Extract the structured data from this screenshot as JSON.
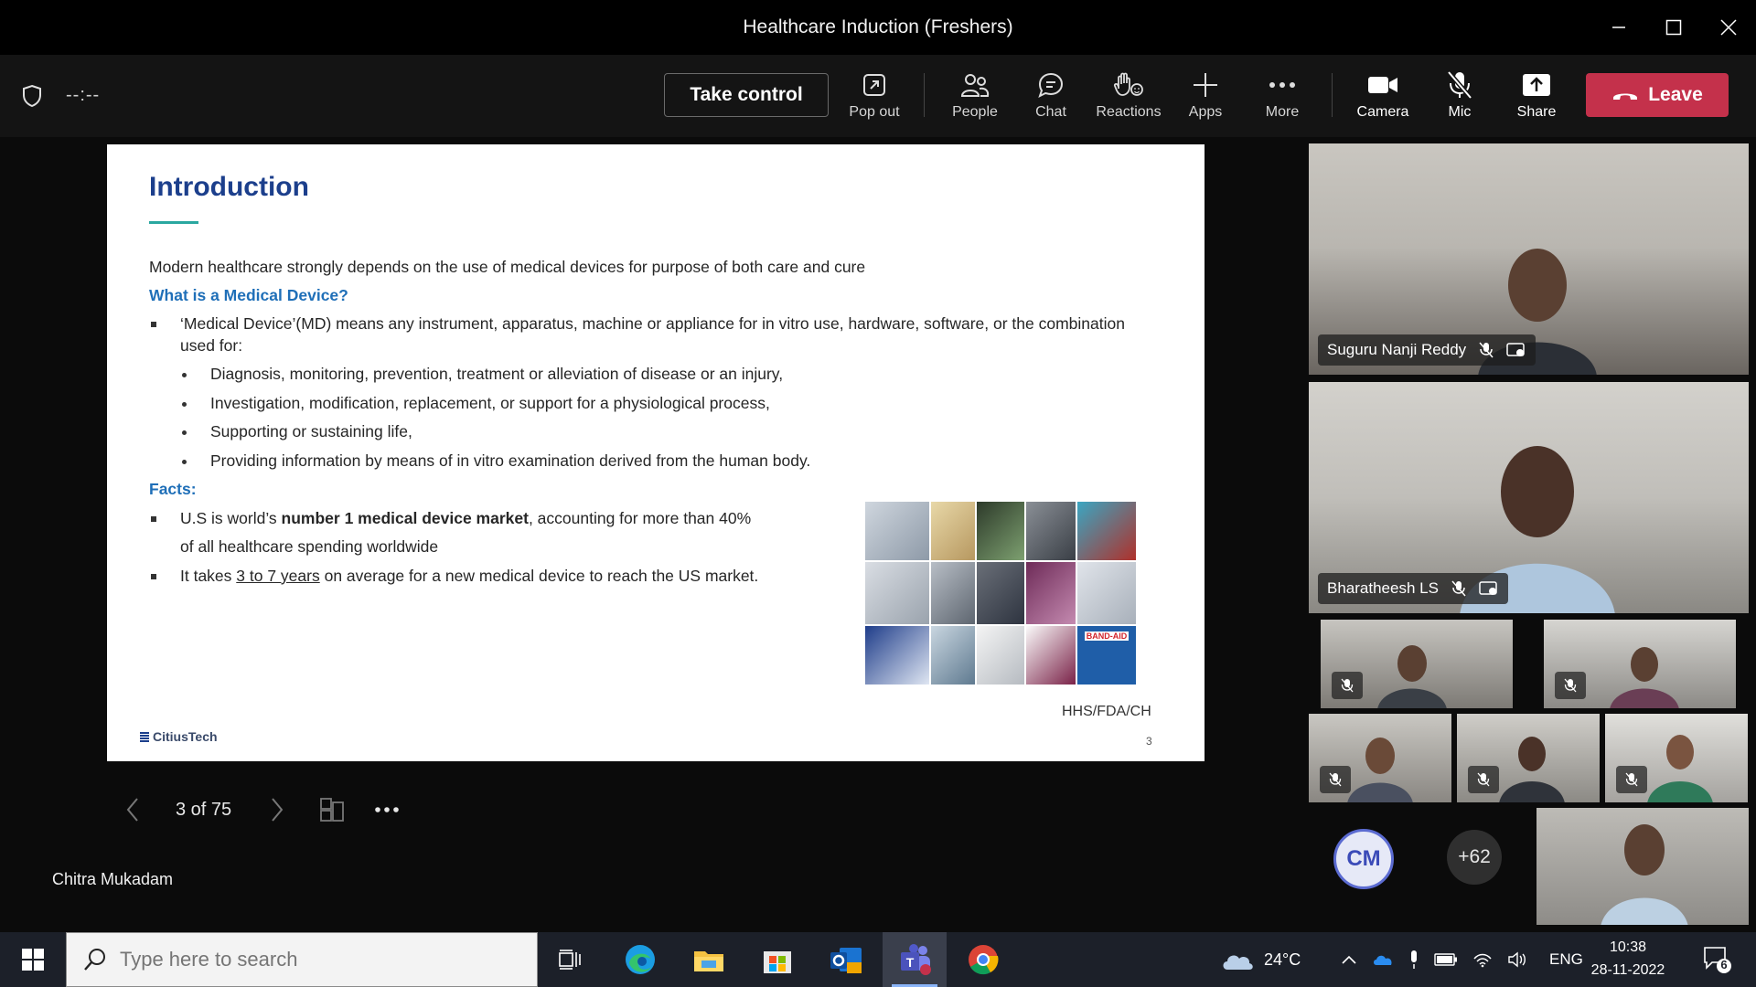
{
  "window": {
    "title": "Healthcare Induction (Freshers)"
  },
  "toolbar": {
    "timer": "--:--",
    "take_control": "Take control",
    "pop_out": "Pop out",
    "people": "People",
    "chat": "Chat",
    "reactions": "Reactions",
    "apps": "Apps",
    "more": "More",
    "camera": "Camera",
    "mic": "Mic",
    "share": "Share",
    "leave": "Leave",
    "leave_color": "#c4314b"
  },
  "slide": {
    "title": "Introduction",
    "intro": "Modern healthcare strongly depends on the use of medical devices for purpose of both care and cure",
    "q_heading": "What is a Medical Device?",
    "definition_line1": "‘Medical Device’(MD) means any instrument, apparatus, machine or appliance for in vitro use, hardware, software, or the combination",
    "definition_line2": "used for:",
    "sub_items": [
      "Diagnosis, monitoring, prevention, treatment or alleviation of disease or an injury,",
      "Investigation, modification, replacement, or support for a physiological process,",
      "Supporting or sustaining life,",
      "Providing information by means of in vitro examination derived from the human body."
    ],
    "facts_heading": "Facts:",
    "fact1_pre": "U.S is world’s ",
    "fact1_bold": "number 1 medical device market",
    "fact1_post": ", accounting for more than 40%",
    "fact1_line2": "of all healthcare spending worldwide",
    "fact2_pre": "It takes ",
    "fact2_underline": "3 to 7 years",
    "fact2_post": " on average for a new medical device to reach the US market.",
    "image_label": "BAND-AID",
    "source": "HHS/FDA/CH",
    "page": "3",
    "brand": "CitiusTech",
    "title_color": "#1c3f8c",
    "heading_color": "#1f6fb8"
  },
  "slide_nav": {
    "counter": "3 of 75"
  },
  "presenter": "Chitra Mukadam",
  "participants": {
    "tile1_name": "Suguru Nanji Reddy",
    "tile2_name": "Bharatheesh LS",
    "avatar_initials": "CM",
    "more_count": "+62"
  },
  "taskbar": {
    "search_placeholder": "Type here to search",
    "weather": "24°C",
    "language": "ENG",
    "time": "10:38",
    "date": "28-11-2022",
    "notifications": "6"
  }
}
